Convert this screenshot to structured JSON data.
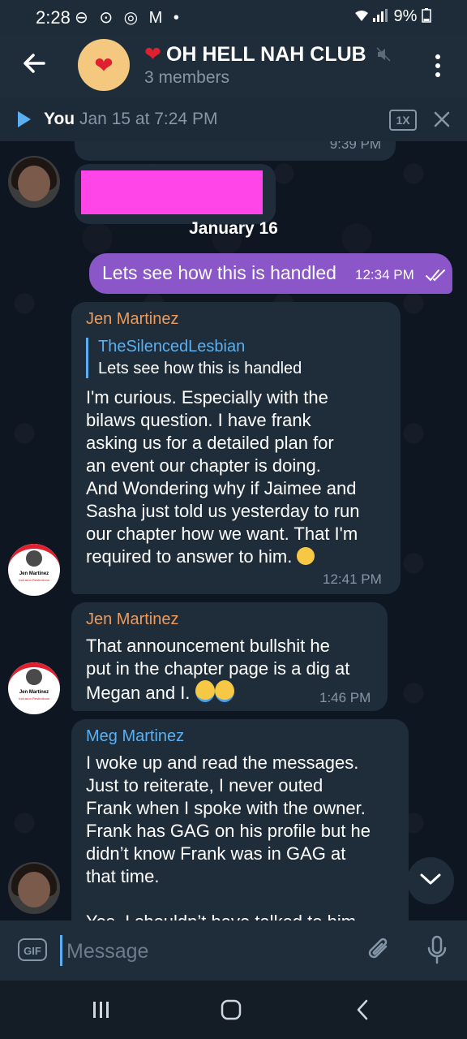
{
  "status_bar": {
    "time": "2:28",
    "left_icons": "⊖ ⊙ ◎ M •",
    "battery": "9%"
  },
  "header": {
    "title": "OH HELL NAH CLUB",
    "heart": "❤️",
    "subtitle": "3 members"
  },
  "audio_bar": {
    "sender": "You",
    "date": "Jan 15 at 7:24 PM",
    "speed": "1X"
  },
  "messages": {
    "top_time": "9:39 PM",
    "date_separator": "January 16",
    "outgoing": {
      "text": "Lets see how this is handled",
      "time": "12:34 PM"
    },
    "jen1": {
      "sender": "Jen Martinez",
      "quote_name": "TheSilencedLesbian",
      "quote_text": "Lets see how this is handled",
      "lines": [
        "I'm curious. Especially with the",
        "bilaws question. I have frank",
        "asking us for a detailed plan for",
        "an event our chapter is doing.",
        "And Wondering why if Jaimee and",
        "Sasha just told us yesterday to run",
        "our chapter how we want. That I'm",
        "required to answer to him."
      ],
      "time": "12:41 PM"
    },
    "jen2": {
      "sender": "Jen Martinez",
      "lines": [
        "That announcement bullshit he",
        "put in the chapter page is a dig at",
        "Megan and I."
      ],
      "time": "1:46 PM"
    },
    "meg": {
      "sender": "Meg Martinez",
      "lines": [
        "I woke up and read the messages.",
        "Just to reiterate, I never outed",
        "Frank when I spoke with the owner.",
        "Frank has GAG on his profile but he",
        "didn’t know Frank was in GAG at",
        "that time.",
        "",
        "Yes, I shouldn’t have talked to him"
      ]
    },
    "badge": {
      "name": "Jen Martinez",
      "sub": "Inclusion Restrictions"
    }
  },
  "input": {
    "gif_label": "GIF",
    "placeholder": "Message"
  },
  "colors": {
    "outgoing_bubble": "#8a56c8",
    "incoming_bubble": "#1f2d3b",
    "jen_name": "#ed9a5a",
    "meg_name": "#5ab0f0",
    "pink_redaction": "#ff44e8"
  }
}
